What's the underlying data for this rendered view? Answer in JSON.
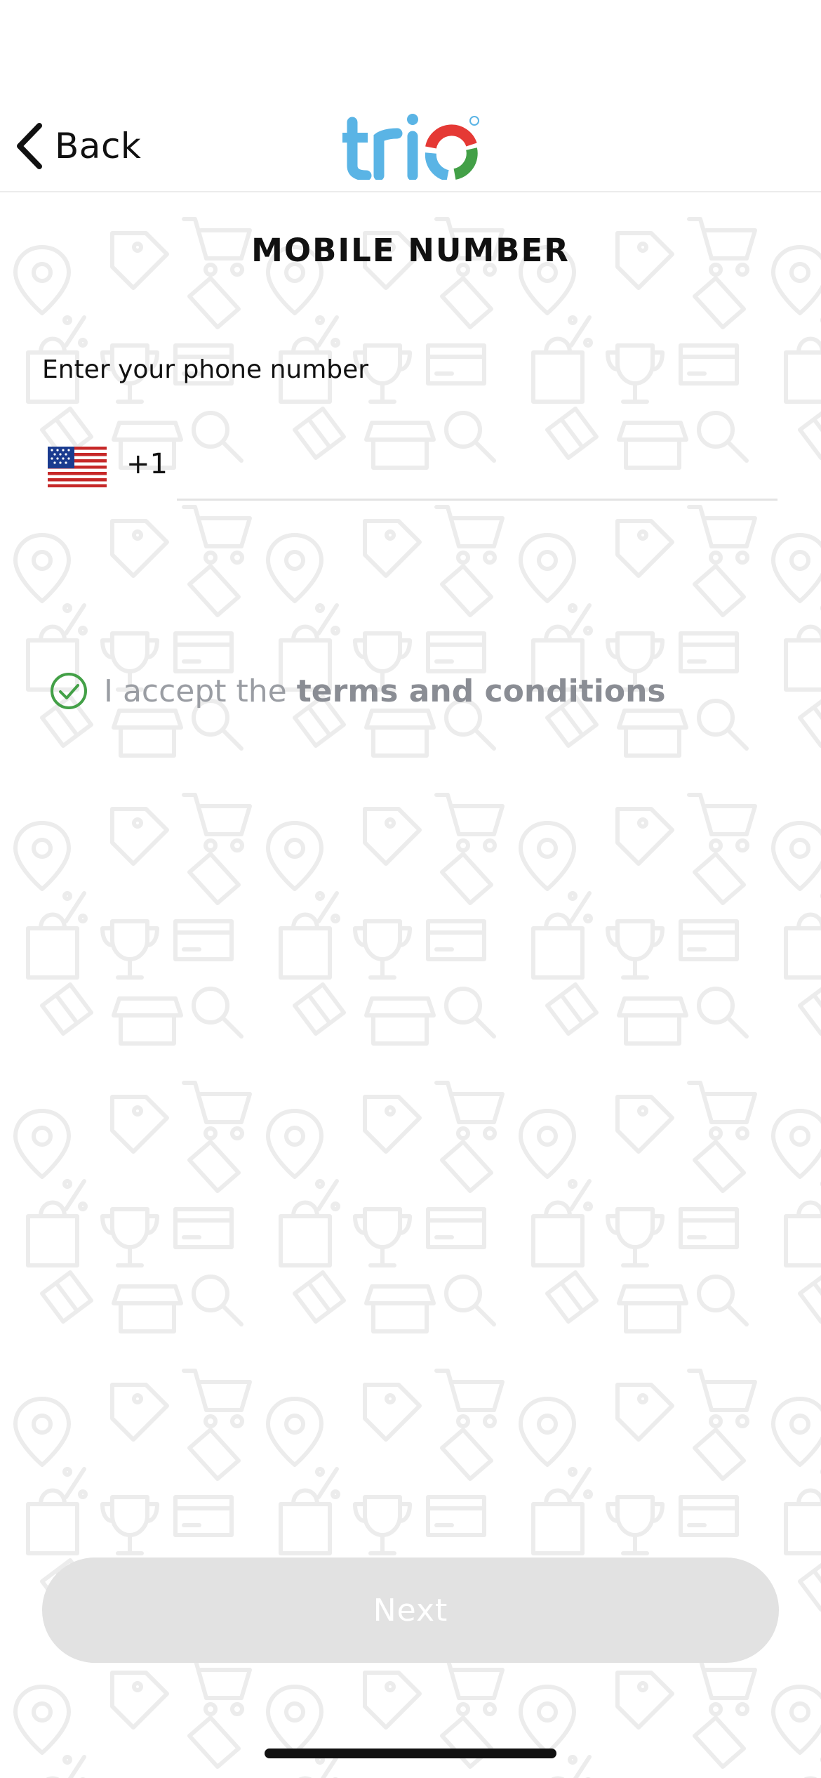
{
  "header": {
    "back_label": "Back",
    "logo_text": "trio",
    "logo_colors": {
      "text": "#5ab4e5",
      "red": "#e53935",
      "green": "#43a047",
      "blue": "#5ab4e5"
    }
  },
  "page_title": "MOBILE NUMBER",
  "phone": {
    "label": "Enter your phone number",
    "country_flag": "us-flag-icon",
    "dial_code": "+1",
    "value": "",
    "placeholder": ""
  },
  "terms": {
    "checked": true,
    "prefix": "I accept the",
    "link_text": "terms and conditions",
    "check_color": "#43a047"
  },
  "next_button": {
    "label": "Next",
    "enabled": false
  },
  "background_icons": [
    "location-pin-icon",
    "tag-icon",
    "shopping-cart-icon",
    "shopping-bag-icon",
    "trophy-icon",
    "credit-card-icon",
    "gift-icon",
    "store-icon",
    "magnifier-icon",
    "percent-icon",
    "phone-icon"
  ]
}
